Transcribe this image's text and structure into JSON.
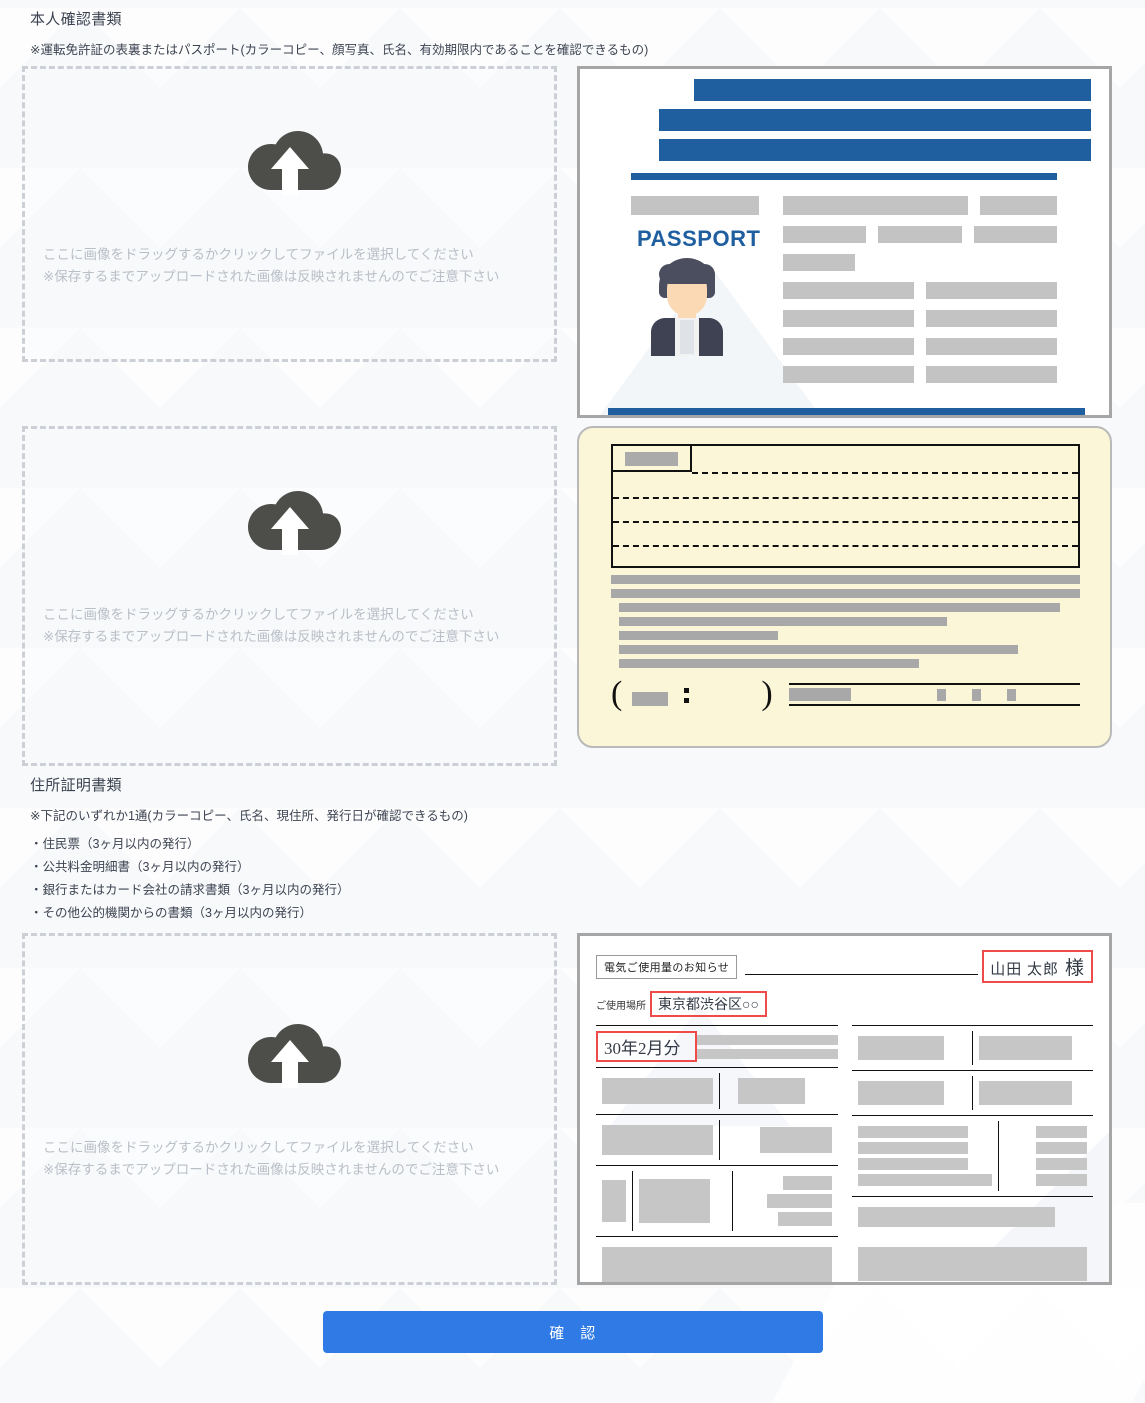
{
  "sections": [
    {
      "title": "本人確認書類",
      "note": "※運転免許証の表裏またはパスポート(カラーコピー、顔写真、氏名、有効期限内であることを確認できるもの)"
    },
    {
      "title": "住所証明書類",
      "note": "※下記のいずれか1通(カラーコピー、氏名、現住所、発行日が確認できるもの)",
      "list": [
        "・住民票（3ヶ月以内の発行）",
        "・公共料金明細書（3ヶ月以内の発行）",
        "・銀行またはカード会社の請求書類（3ヶ月以内の発行）",
        "・その他公的機関からの書類（3ヶ月以内の発行）"
      ]
    }
  ],
  "dropzone": {
    "icon": "cloud-upload-icon",
    "line1": "ここに画像をドラッグするかクリックしてファイルを選択してください",
    "line2": "※保存するまでアップロードされた画像は反映されませんのでご注意下さい"
  },
  "previews": {
    "passport": {
      "label": "PASSPORT",
      "accent_color": "#1f5fa0",
      "border_color": "#a6a6a6"
    },
    "licence": {
      "background_color": "#fbf6d8",
      "border_color": "#b9b9b9"
    },
    "bill": {
      "title": "電気ご使用量のお知らせ",
      "name": "山田 太郎",
      "name_suffix": "様",
      "place_label": "ご使用場所",
      "place_value": "東京都渋谷区○○",
      "month": "30年2月分",
      "highlight_color": "#ef4b4b",
      "border_color": "#a6a6a6"
    }
  },
  "footer": {
    "confirm_label": "確　認",
    "confirm_color": "#2f7ae5"
  }
}
